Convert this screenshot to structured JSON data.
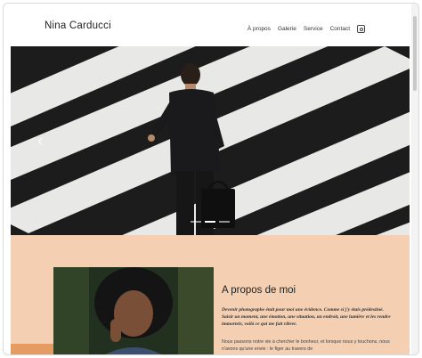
{
  "header": {
    "brand": "Nina Carducci",
    "nav": [
      "À propos",
      "Galerie",
      "Service",
      "Contact"
    ],
    "icons": {
      "social": "instagram-icon"
    }
  },
  "hero": {
    "carousel_icons": {
      "prev": "chevron-left-icon"
    },
    "indicators": 3,
    "active_indicator": 1
  },
  "about": {
    "title": "A propos de moi",
    "quote": "Devenir photographe était pour moi une évidence. Comme si j'y étais prédestiné. Saisir un moment, une émotion, une situation, un endroit, une lumière et les rendre immortels, voilà ce qui me fait vibrer.",
    "body": "Nous passons notre vie à chercher le bonheur, et lorsque nous y touchons, nous n'avons qu'une envie : le figer au travers de"
  },
  "colors": {
    "about_bg": "#f4cfb1",
    "accent": "#e49b64"
  }
}
